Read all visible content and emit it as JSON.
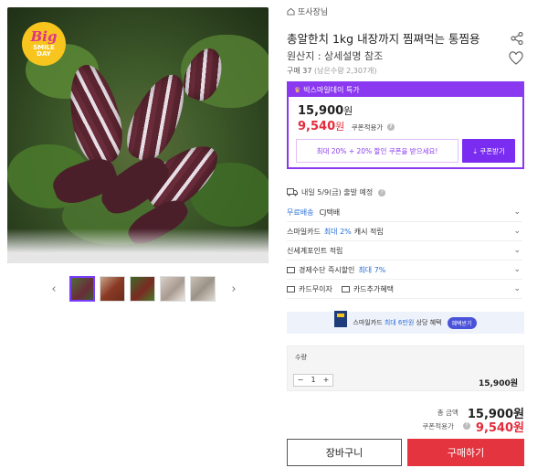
{
  "badge": {
    "line1": "Big",
    "line2": "SMILE",
    "line3": "DAY"
  },
  "breadcrumb": {
    "label": "또사장님"
  },
  "product": {
    "title": "총알한치 1kg 내장까지 찜쪄먹는 통찜용",
    "origin": "원산지 : 상세설명 참조",
    "purchase_count": "구매 37",
    "purchase_sub": "(남은수량 2,307개)"
  },
  "deal": {
    "header": "빅스마일데이 특가",
    "price": "15,900",
    "coupon_price": "9,540",
    "won": "원",
    "coupon_note": "쿠폰적용가",
    "coupon_banner": "최대 20% + 20% 할인 쿠폰을 받으세요!",
    "coupon_button": "쿠폰받기"
  },
  "shipping": {
    "text": "내일 5/9(금) 출발 예정"
  },
  "options": [
    {
      "left": "무료배송",
      "right": "CJ택배"
    },
    {
      "left": "스마일카드",
      "right": "최대 2%",
      "tail": "캐시 적립"
    },
    {
      "left": "신세계포인트 적립"
    },
    {
      "left": "경제수단 즉시할인",
      "right": "최대 7%"
    },
    {
      "left": "카드무이자",
      "right": "카드추가혜택"
    }
  ],
  "smile_banner": {
    "text": "스마일카드",
    "highlight": "최대 6만원",
    "tail": "상당 혜택",
    "tag": "혜택받기"
  },
  "quantity": {
    "label": "수량",
    "minus": "−",
    "value": "1",
    "plus": "+",
    "price": "15,900원"
  },
  "totals": {
    "total_label": "총 금액",
    "total_value": "15,900원",
    "coupon_label": "쿠폰적용가",
    "coupon_value": "9,540원"
  },
  "buttons": {
    "cart": "장바구니",
    "buy": "구매하기"
  },
  "colors": {
    "accent": "#8b39f0",
    "sale": "#e32b3b",
    "buy": "#e3343f",
    "link": "#2a6fd6"
  }
}
